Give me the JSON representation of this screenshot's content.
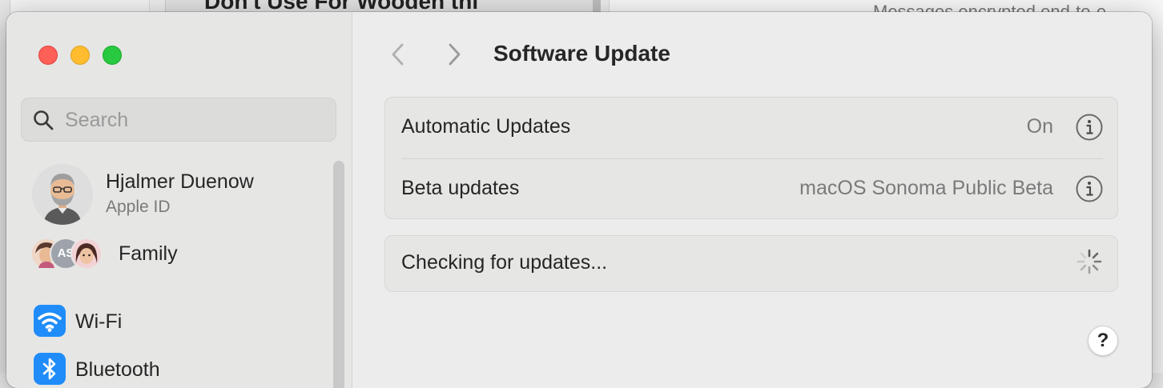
{
  "background": {
    "right_top_text": "Messages encrypted end-to-e",
    "doc_text": "Don't Use For Wooden thi"
  },
  "window": {
    "traffic_lights": {
      "close": "#fe5f57",
      "minimize": "#febc2e",
      "zoom": "#28c840"
    }
  },
  "sidebar": {
    "search": {
      "placeholder": "Search",
      "value": ""
    },
    "account": {
      "name": "Hjalmer Duenow",
      "subtitle": "Apple ID"
    },
    "family": {
      "label": "Family",
      "avatar_initials": "AS"
    },
    "items": [
      {
        "label": "Wi-Fi",
        "icon": "wifi-icon"
      },
      {
        "label": "Bluetooth",
        "icon": "bluetooth-icon"
      }
    ]
  },
  "content": {
    "title": "Software Update",
    "settings": [
      {
        "label": "Automatic Updates",
        "value": "On"
      },
      {
        "label": "Beta updates",
        "value": "macOS Sonoma Public Beta"
      }
    ],
    "status": {
      "label": "Checking for updates..."
    },
    "help_label": "?"
  },
  "colors": {
    "accent": "#1f8cf9",
    "window_bg": "#ececec",
    "sidebar_bg": "#e6e6e5"
  }
}
